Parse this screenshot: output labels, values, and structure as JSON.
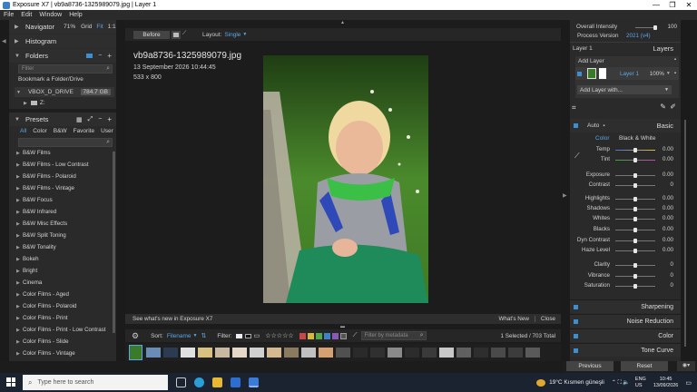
{
  "window": {
    "title": "Exposure X7 | vb9a8736-1325989079.jpg | Layer 1",
    "controls": [
      "—",
      "❐",
      "✕"
    ]
  },
  "menu": [
    "File",
    "Edit",
    "Window",
    "Help"
  ],
  "left": {
    "navigator": {
      "label": "Navigator",
      "zoom": "71%",
      "grid": "Grid",
      "fit": "Fit",
      "one": "1:1"
    },
    "histogram": {
      "label": "Histogram"
    },
    "folders": {
      "label": "Folders",
      "filter_placeholder": "Filter",
      "bookmark": "Bookmark a Folder/Drive",
      "drive": "VBOX_D_DRIVE",
      "drive_size": "784.7 GB",
      "sub": "Z:"
    },
    "presets": {
      "label": "Presets",
      "tabs": [
        "All",
        "Color",
        "B&W",
        "Favorite",
        "User"
      ],
      "items": [
        "B&W Films",
        "B&W Films - Low Contrast",
        "B&W Films - Polaroid",
        "B&W Films - Vintage",
        "B&W Focus",
        "B&W Infrared",
        "B&W Misc Effects",
        "B&W Split Toning",
        "B&W Tonality",
        "Bokeh",
        "Bright",
        "Cinema",
        "Color Films - Aged",
        "Color Films - Polaroid",
        "Color Films - Print",
        "Color Films - Print - Low Contrast",
        "Color Films - Slide",
        "Color Films - Vintage",
        "Color Focus"
      ]
    }
  },
  "center": {
    "before_label": "Before",
    "layout_label": "Layout:",
    "layout_value": "Single",
    "filename": "vb9a8736-1325989079.jpg",
    "date": "13 September 2026 10:44:45",
    "dimensions": "533 x 800",
    "whatsnew_text": "See what's new in Exposure X7",
    "whatsnew_button": "What's New",
    "close_button": "Close",
    "sort_label": "Sort:",
    "sort_value": "Filename",
    "filter_label": "Filter:",
    "metadata_placeholder": "Filter by metadata",
    "selection": "1 Selected / 703 Total"
  },
  "right": {
    "overall_intensity_label": "Overall Intensity",
    "overall_intensity_value": "100",
    "process_version_label": "Process Version",
    "process_version_value": "2021 (v4)",
    "layer_current": "Layer 1",
    "layers_label": "Layers",
    "add_layer": "Add Layer",
    "layer_name": "Layer 1",
    "layer_opacity": "100%",
    "add_layer_with": "Add Layer with...",
    "auto_label": "Auto",
    "basic_label": "Basic",
    "color_tab": "Color",
    "bw_tab": "Black & White",
    "adjustments": [
      {
        "label": "Temp",
        "value": "0.00"
      },
      {
        "label": "Tint",
        "value": "0.00"
      },
      {
        "label": "Exposure",
        "value": "0.00"
      },
      {
        "label": "Contrast",
        "value": "0"
      },
      {
        "label": "Highlights",
        "value": "0.00"
      },
      {
        "label": "Shadows",
        "value": "0.00"
      },
      {
        "label": "Whites",
        "value": "0.00"
      },
      {
        "label": "Blacks",
        "value": "0.00"
      },
      {
        "label": "Dyn Contrast",
        "value": "0.00"
      },
      {
        "label": "Haze Level",
        "value": "0.00"
      },
      {
        "label": "Clarity",
        "value": "0"
      },
      {
        "label": "Vibrance",
        "value": "0"
      },
      {
        "label": "Saturation",
        "value": "0"
      }
    ],
    "collapsed_panels": [
      "Sharpening",
      "Noise Reduction",
      "Color",
      "Tone Curve"
    ],
    "previous_button": "Previous",
    "reset_button": "Reset"
  },
  "taskbar": {
    "search_placeholder": "Type here to search",
    "weather": "19°C  Kısmen güneşli",
    "lang": "ENG",
    "region": "US",
    "time": "10:45",
    "date": "13/09/2026"
  },
  "colors": {
    "accent": "#3d8fd0",
    "panel": "#2a2a2a",
    "background": "#1c1c1c"
  }
}
